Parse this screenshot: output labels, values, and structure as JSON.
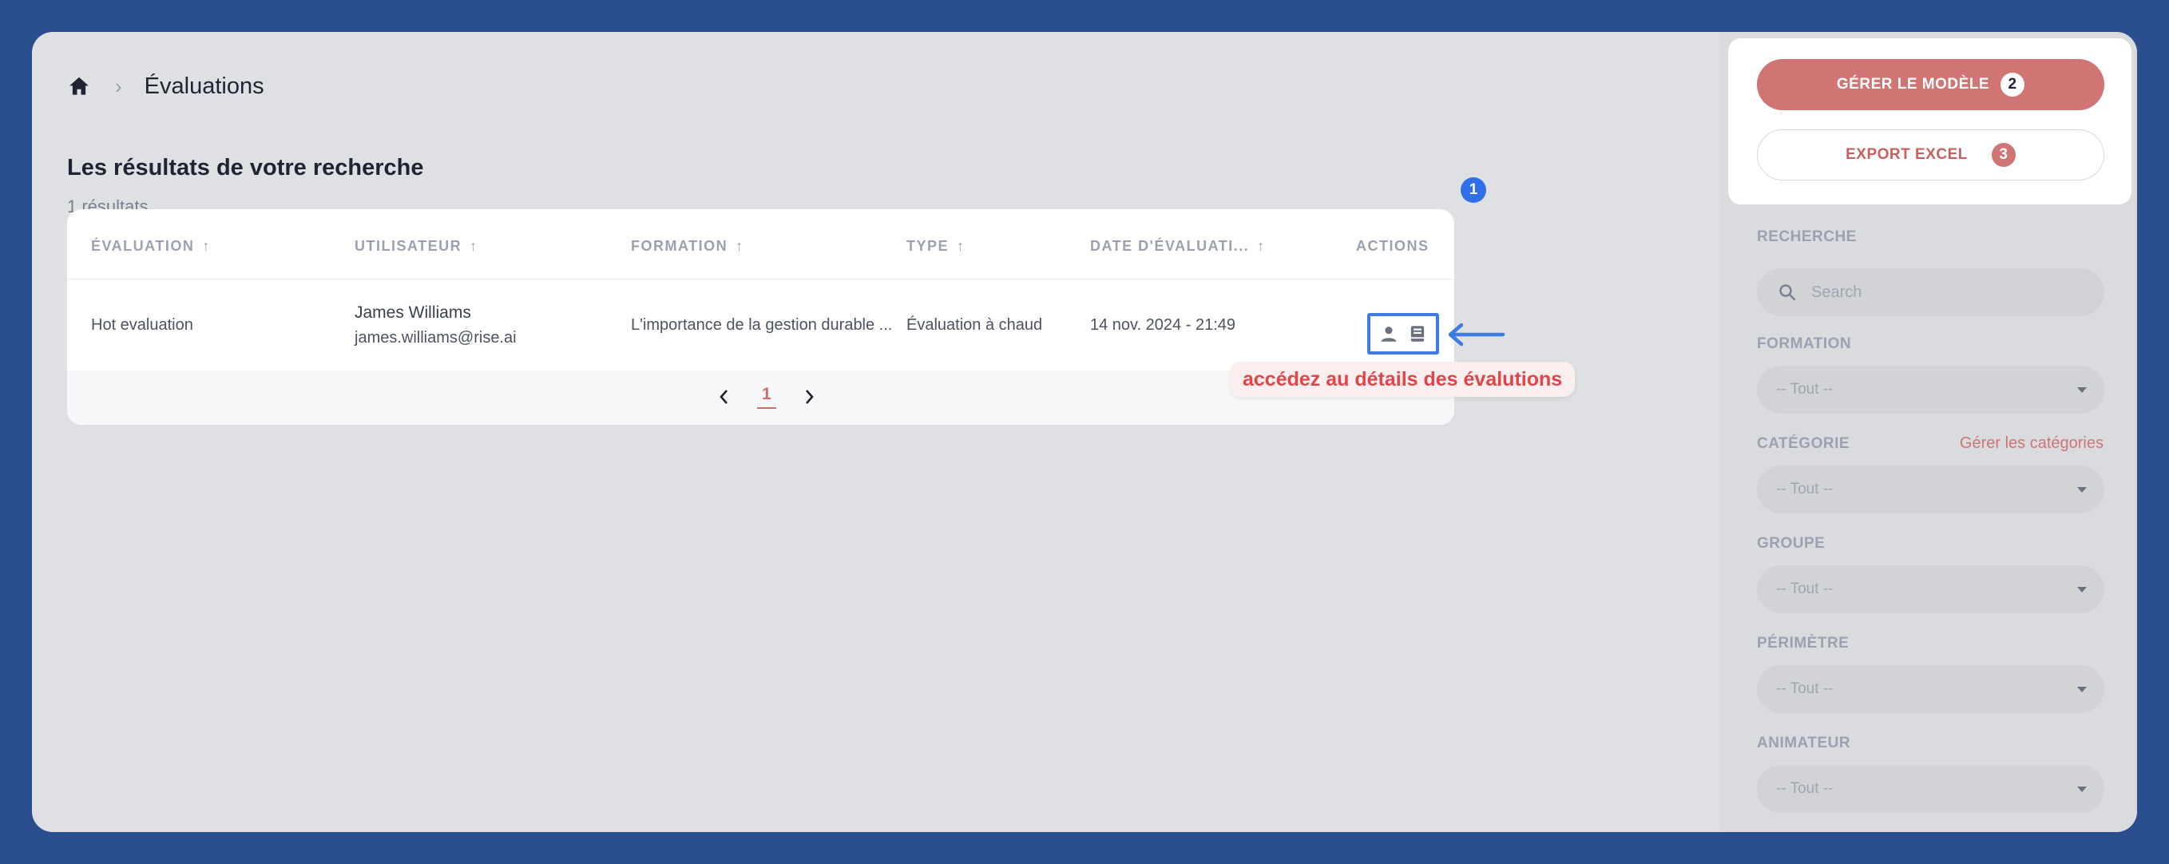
{
  "breadcrumb": {
    "home_icon": "home-icon",
    "separator": "›",
    "title": "Évaluations"
  },
  "results": {
    "title": "Les résultats de votre recherche",
    "count": "1 résultats"
  },
  "table": {
    "columns": [
      {
        "label": "ÉVALUATION",
        "sort": true
      },
      {
        "label": "UTILISATEUR",
        "sort": true
      },
      {
        "label": "FORMATION",
        "sort": true
      },
      {
        "label": "TYPE",
        "sort": true
      },
      {
        "label": "DATE D'ÉVALUATI...",
        "sort": true
      },
      {
        "label": "ACTIONS",
        "sort": false
      }
    ],
    "rows": [
      {
        "evaluation": "Hot evaluation",
        "user_name": "James Williams",
        "user_email": "james.williams@rise.ai",
        "formation": "L'importance de la gestion durable ...",
        "type": "Évaluation à chaud",
        "date": "14 nov. 2024 - 21:49",
        "actions": [
          "user-icon",
          "book-icon"
        ]
      }
    ]
  },
  "pagination": {
    "current_page": "1"
  },
  "annotations": {
    "badge_1": "1",
    "callout": "accédez au détails des évalutions",
    "highlight_color": "#3f7be3"
  },
  "sidebar": {
    "manage_model_label": "GÉRER LE MODÈLE",
    "manage_model_badge": "2",
    "export_label": "EXPORT EXCEL",
    "export_badge": "3",
    "search_label": "RECHERCHE",
    "search_placeholder": "Search",
    "filters": [
      {
        "label": "FORMATION",
        "value": "-- Tout --"
      },
      {
        "label": "CATÉGORIE",
        "value": "-- Tout --"
      },
      {
        "label": "GROUPE",
        "value": "-- Tout --"
      },
      {
        "label": "PÉRIMÈTRE",
        "value": "-- Tout --"
      },
      {
        "label": "ANIMATEUR",
        "value": "-- Tout --"
      }
    ],
    "manage_categories_link": "Gérer les catégories"
  },
  "colors": {
    "accent": "#d07474",
    "background": "#2b4f8e",
    "badge_blue": "#2f6fe8",
    "callout_text": "#e0454a"
  }
}
